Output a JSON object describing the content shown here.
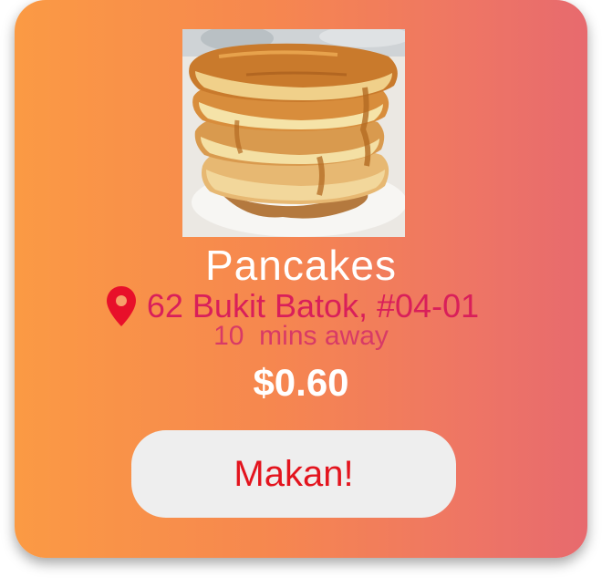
{
  "item": {
    "name": "Pancakes",
    "address": "62 Bukit Batok, #04-01",
    "distance": "10  mins away",
    "price": "$0.60"
  },
  "actions": {
    "order_label": "Makan!"
  },
  "icons": {
    "location": "map-pin-icon"
  },
  "colors": {
    "gradient_start": "#fb9a44",
    "gradient_end": "#e76a6e",
    "address_text": "#d91f5a",
    "pin": "#e8102a",
    "button_text": "#e3141e",
    "button_bg": "#eeeeee"
  }
}
